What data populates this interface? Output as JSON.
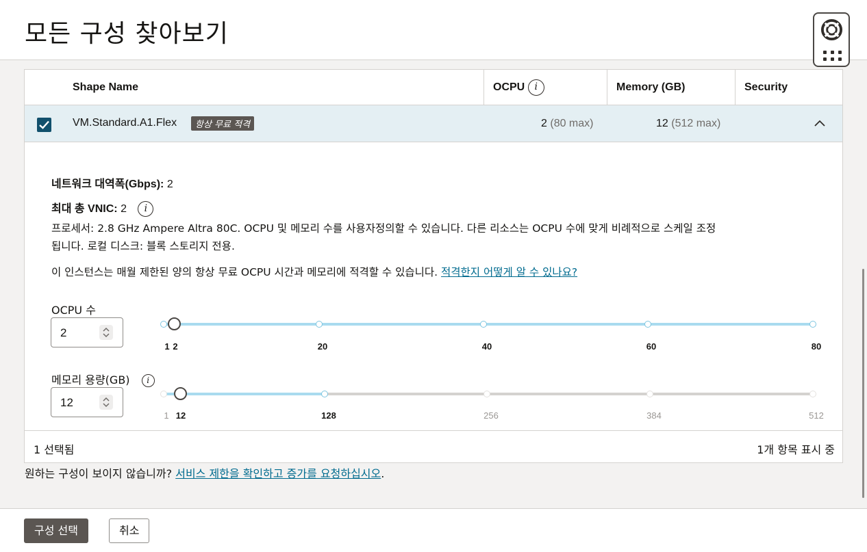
{
  "header": {
    "title": "모든 구성 찾아보기"
  },
  "help_widget": {
    "icon": "lifebuoy-icon",
    "grid_icon": "apps-grid-icon"
  },
  "table": {
    "columns": {
      "shape_name": "Shape Name",
      "ocpu": "OCPU",
      "memory": "Memory (GB)",
      "security": "Security"
    },
    "row": {
      "name": "VM.Standard.A1.Flex",
      "badge": "항상 무료 적격",
      "ocpu_value": "2",
      "ocpu_max": "(80 max)",
      "memory_value": "12",
      "memory_max": "(512 max)"
    },
    "detail": {
      "network_label": "네트워크 대역폭(Gbps):",
      "network_value": "2",
      "vnic_label": "최대 총 VNIC:",
      "vnic_value": "2",
      "processor_line1": "프로세서: 2.8 GHz Ampere Altra 80C. OCPU 및 메모리 수를 사용자정의할 수 있습니다. 다른 리소스는 OCPU 수에 맞게 비례적으로 스케일 조정",
      "processor_line2": "됩니다. 로컬 디스크: 블록 스토리지 전용.",
      "eligibility_text": "이 인스턴스는 매월 제한된 양의 항상 무료 OCPU 시간과 메모리에 적격할 수 있습니다.",
      "eligibility_link": "적격한지 어떻게 알 수 있나요?",
      "ocpu_slider": {
        "label": "OCPU 수",
        "value": "2",
        "min": 1,
        "max": 80,
        "current": 2,
        "ticks": [
          "1",
          "2",
          "20",
          "40",
          "60",
          "80"
        ]
      },
      "memory_slider": {
        "label": "메모리 용량(GB)",
        "value": "12",
        "min": 1,
        "max": 512,
        "current": 12,
        "allowed_max": 128,
        "ticks": [
          "1",
          "12",
          "128",
          "256",
          "384",
          "512"
        ]
      }
    },
    "footer": {
      "selected": "1 선택됨",
      "showing": "1개 항목 표시 중"
    }
  },
  "note": {
    "text": "원하는 구성이 보이지 않습니까?",
    "link": "서비스 제한을 확인하고 증가를 요청하십시오",
    "period": "."
  },
  "buttons": {
    "select": "구성 선택",
    "cancel": "취소"
  },
  "colors": {
    "track_active": "#a9dbef",
    "track_inactive": "#d4d2cf",
    "checkbox": "#11506c",
    "link": "#006b8f"
  }
}
